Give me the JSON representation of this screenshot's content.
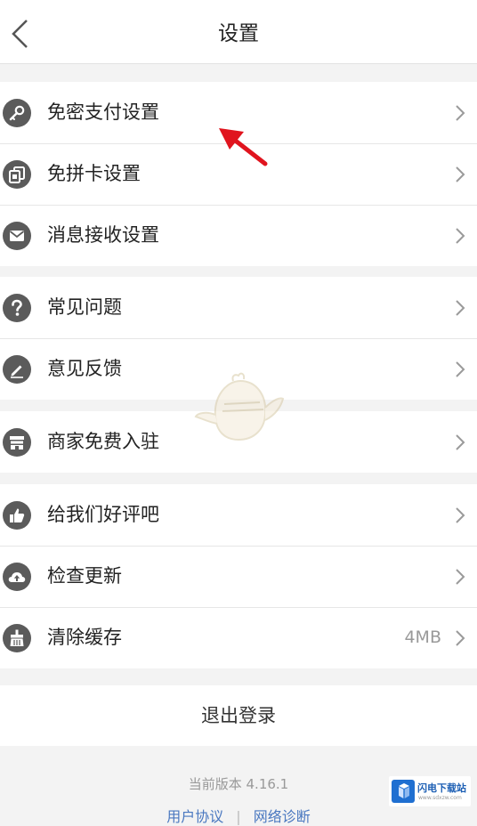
{
  "navbar": {
    "title": "设置",
    "back_icon": "chevron-left-icon"
  },
  "groups": [
    {
      "items": [
        {
          "label": "免密支付设置",
          "icon": "key-icon",
          "value": ""
        },
        {
          "label": "免拼卡设置",
          "icon": "card-icon",
          "value": ""
        },
        {
          "label": "消息接收设置",
          "icon": "envelope-icon",
          "value": ""
        }
      ]
    },
    {
      "items": [
        {
          "label": "常见问题",
          "icon": "question-icon",
          "value": ""
        },
        {
          "label": "意见反馈",
          "icon": "pencil-icon",
          "value": ""
        }
      ]
    },
    {
      "items": [
        {
          "label": "商家免费入驻",
          "icon": "store-icon",
          "value": ""
        }
      ]
    },
    {
      "items": [
        {
          "label": "给我们好评吧",
          "icon": "thumbs-up-icon",
          "value": ""
        },
        {
          "label": "检查更新",
          "icon": "cloud-upload-icon",
          "value": ""
        },
        {
          "label": "清除缓存",
          "icon": "broom-icon",
          "value": "4MB"
        }
      ]
    }
  ],
  "logout": {
    "label": "退出登录"
  },
  "footer": {
    "version": "当前版本 4.16.1",
    "links": [
      "用户协议",
      "网络诊断"
    ],
    "separator": "|"
  },
  "watermark": {
    "text": "闪电下载站",
    "subtext": "www.sdxzw.com"
  },
  "colors": {
    "background": "#f3f3f3",
    "icon": "#5b5b5b",
    "link": "#4a78c0",
    "annotation_arrow": "#e0141e"
  }
}
